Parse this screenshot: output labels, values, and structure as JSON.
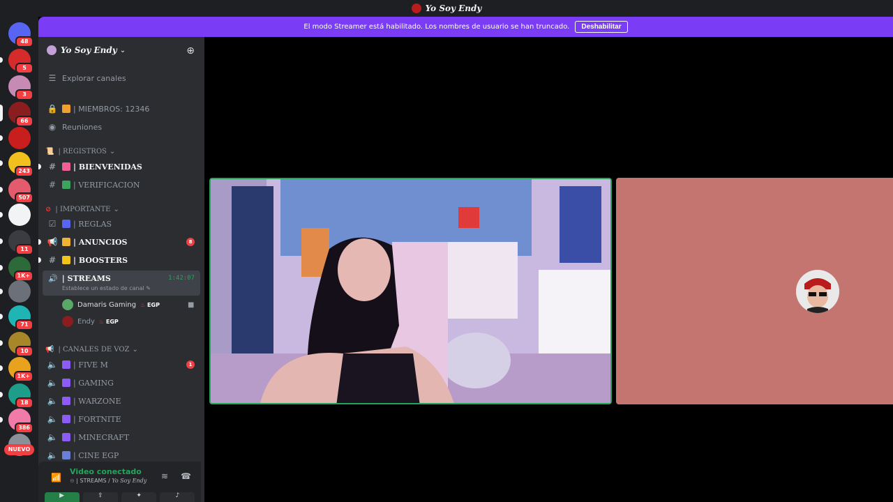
{
  "window": {
    "title": "Yo Soy Endy"
  },
  "banner": {
    "text": "El modo Streamer está habilitado. Los nombres de usuario se han truncado.",
    "button": "Deshabilitar"
  },
  "guilds": [
    {
      "badge": "48"
    },
    {
      "badge": "5"
    },
    {
      "badge": "3"
    },
    {
      "badge": "66"
    },
    {
      "badge": ""
    },
    {
      "badge": "243"
    },
    {
      "badge": "507"
    },
    {
      "badge": ""
    },
    {
      "badge": "11"
    },
    {
      "badge": "1K+"
    },
    {
      "badge": ""
    },
    {
      "badge": "71"
    },
    {
      "badge": "10"
    },
    {
      "badge": "1K+"
    },
    {
      "badge": "18"
    },
    {
      "badge": "386"
    }
  ],
  "guild_new_label": "NUEVO",
  "server": {
    "name": "Yo Soy Endy"
  },
  "sidebar": {
    "explore": "Explorar canales",
    "members": "| MIEMBROS: 12346",
    "meetings": "Reuniones",
    "cat_registros": "| REGISTROS",
    "ch_bienvenidas": "| BIENVENIDAS",
    "ch_verificacion": "| VERIFICACION",
    "cat_importante": "| IMPORTANTE",
    "ch_reglas": "| REGLAS",
    "ch_anuncios": "| ANUNCIOS",
    "ch_anuncios_badge": "8",
    "ch_boosters": "| BOOSTERS",
    "ch_streams": "| STREAMS",
    "streams_time": "1:42:07",
    "streams_status": "Establece un estado de canal",
    "user1": "Damaris Gaming",
    "user1_tag": "EGP",
    "user2": "Endy",
    "user2_tag": "EGP",
    "cat_voz": "| CANALES DE VOZ",
    "ch_fivem": "| FIVE M",
    "ch_fivem_badge": "1",
    "ch_gaming": "| GAMING",
    "ch_warzone": "| WARZONE",
    "ch_fortnite": "| FORTNITE",
    "ch_minecraft": "| MINECRAFT",
    "ch_cine": "| CINE EGP"
  },
  "voice": {
    "status": "Video conectado",
    "channel": "| STREAMS /",
    "server": "Yo Soy Endy"
  },
  "colors": {
    "accent": "#7a3cf5",
    "connected": "#23a55a",
    "badge": "#f23f43",
    "tile": "#c47570"
  }
}
